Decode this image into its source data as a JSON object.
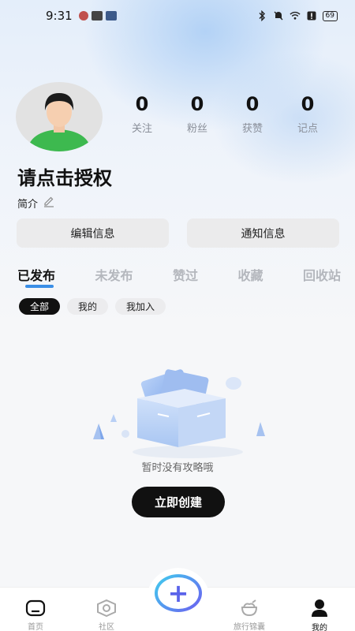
{
  "status_bar": {
    "time": "9:31",
    "battery": "69"
  },
  "profile": {
    "username": "请点击授权",
    "bio_label": "简介",
    "stats": [
      {
        "value": "0",
        "label": "关注"
      },
      {
        "value": "0",
        "label": "粉丝"
      },
      {
        "value": "0",
        "label": "获赞"
      },
      {
        "value": "0",
        "label": "记点"
      }
    ]
  },
  "actions": {
    "edit_info": "编辑信息",
    "notifications": "通知信息"
  },
  "tabs": [
    {
      "label": "已发布",
      "active": true
    },
    {
      "label": "未发布"
    },
    {
      "label": "赞过"
    },
    {
      "label": "收藏"
    },
    {
      "label": "回收站"
    }
  ],
  "filters": [
    {
      "label": "全部",
      "active": true
    },
    {
      "label": "我的"
    },
    {
      "label": "我加入"
    }
  ],
  "empty_state": {
    "message": "暂时没有攻略哦",
    "create_label": "立即创建"
  },
  "bottom_nav": [
    {
      "label": "首页",
      "icon": "home-icon"
    },
    {
      "label": "社区",
      "icon": "community-icon"
    },
    {
      "label": "旅行锦囊",
      "icon": "travel-bag-icon"
    },
    {
      "label": "我的",
      "icon": "profile-icon",
      "active": true
    }
  ],
  "colors": {
    "accent": "#3a8ee6",
    "primary_dark": "#111111",
    "add_gradient_start": "#3fd0ee",
    "add_gradient_end": "#6d5cf0"
  }
}
